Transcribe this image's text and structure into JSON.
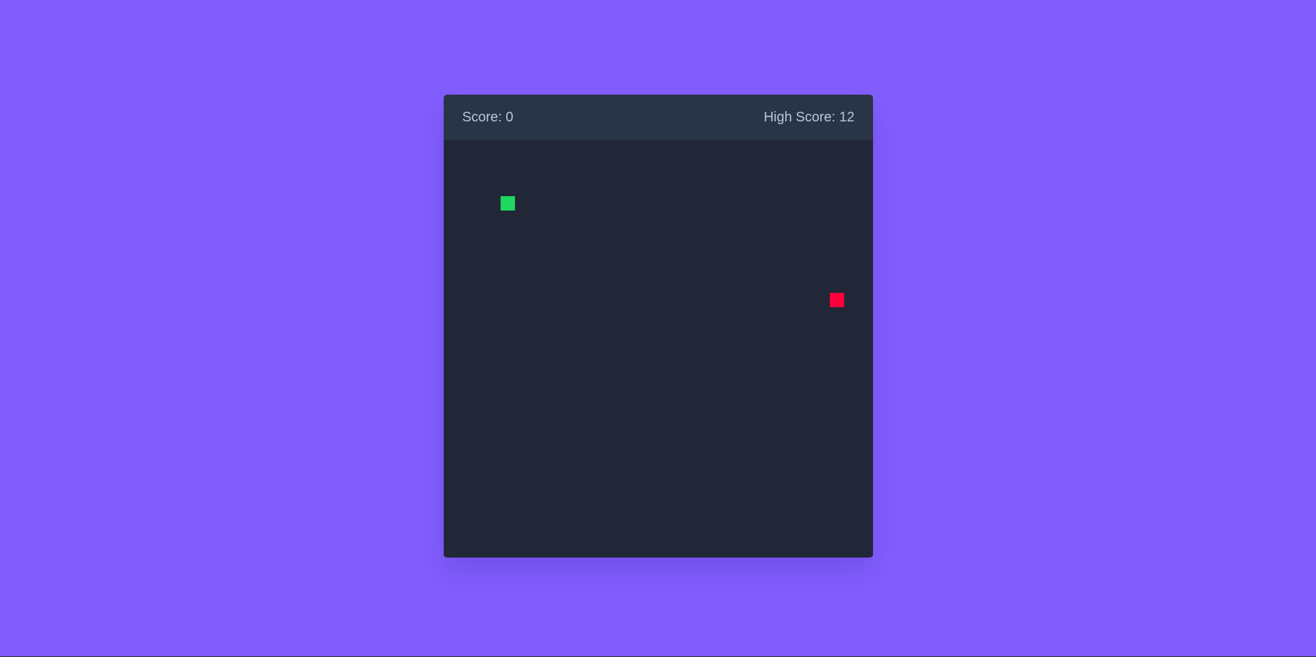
{
  "game": {
    "score_text": "Score: 0",
    "high_score_text": "High Score: 12",
    "score": 0,
    "high_score": 12
  },
  "pieces": {
    "snake_head": {
      "icon": "snake-head-square",
      "color": "#1ED760"
    },
    "food": {
      "icon": "food-square",
      "color": "#FF003D"
    }
  },
  "colors": {
    "background": "#835EFF",
    "header": "#293447",
    "board": "#222738",
    "header_text": "#B8C6DC"
  }
}
